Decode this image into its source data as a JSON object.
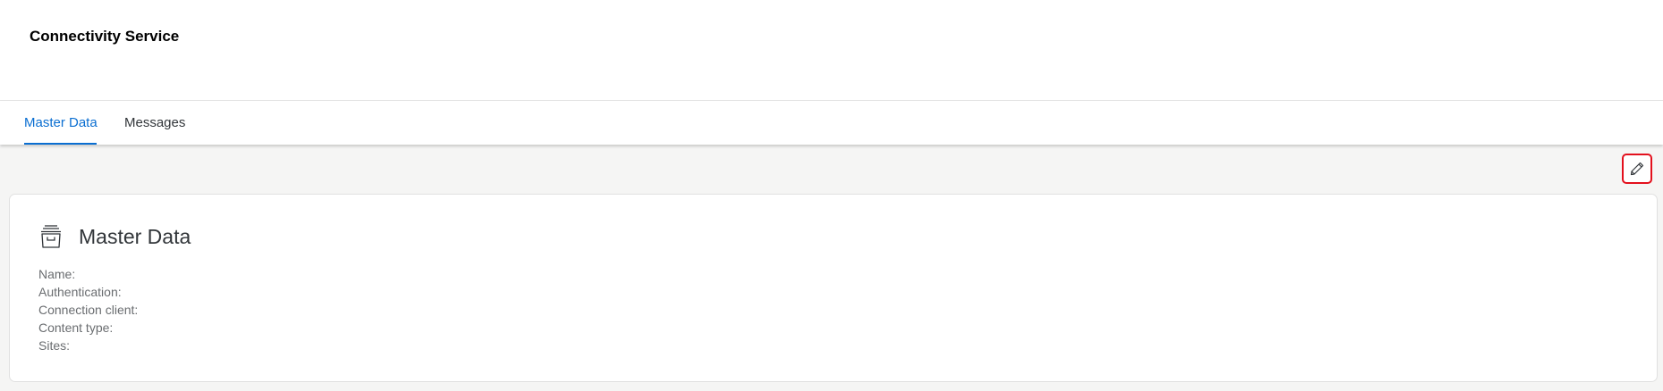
{
  "header": {
    "title": "Connectivity Service"
  },
  "tabs": [
    {
      "label": "Master Data",
      "active": true
    },
    {
      "label": "Messages",
      "active": false
    }
  ],
  "toolbar": {
    "edit_icon": "pencil-icon"
  },
  "card": {
    "icon": "archive-box-icon",
    "title": "Master Data",
    "fields": [
      "Name:",
      "Authentication:",
      "Connection client:",
      "Content type:",
      "Sites:"
    ]
  },
  "colors": {
    "accent": "#0a6ed1",
    "highlight": "#e3101d",
    "background": "#f5f5f4"
  }
}
